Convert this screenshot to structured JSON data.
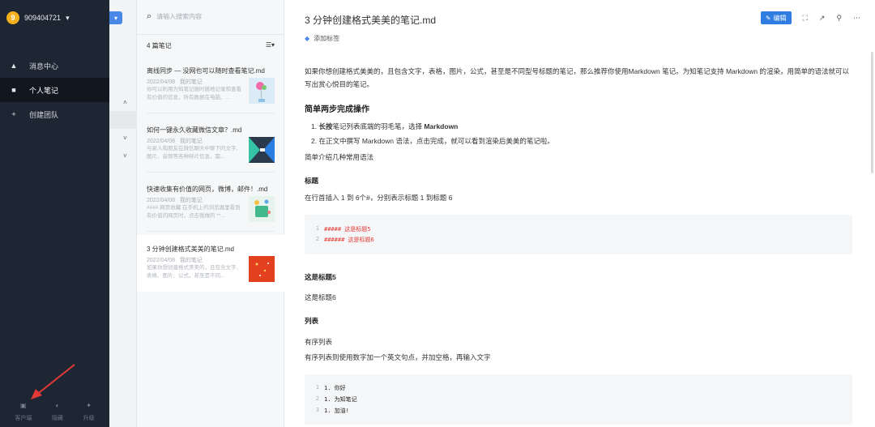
{
  "sidebar": {
    "avatar_text": "9",
    "username": "909404721",
    "nav": [
      {
        "label": "消息中心",
        "icon": "bell-icon",
        "glyph": "▲"
      },
      {
        "label": "个人笔记",
        "icon": "note-icon",
        "glyph": "■"
      },
      {
        "label": "创建团队",
        "icon": "plus-icon",
        "glyph": "+"
      }
    ],
    "bottom": [
      {
        "label": "客户端",
        "icon": "client-icon",
        "glyph": "▣"
      },
      {
        "label": "隐藏",
        "icon": "hide-icon",
        "glyph": "◐"
      },
      {
        "label": "升级",
        "icon": "upgrade-icon",
        "glyph": "✦"
      }
    ]
  },
  "notelist": {
    "search_placeholder": "请输入搜索内容",
    "count_label": "4 篇笔记",
    "notes": [
      {
        "title": "离线同步 — 没网也可以随时查看笔记.md",
        "date": "2022/04/08",
        "folder": "我的笔记",
        "snippet": "你可以利用为知笔记随时随地记录和查看有价值的信息，所有数据在电脑、..."
      },
      {
        "title": "如何一键永久收藏微信文章？.md",
        "date": "2022/04/08",
        "folder": "我的笔记",
        "snippet": "与家人和朋友在微信聊天中聊下的文字、图片、音频等各种碎片信息，需..."
      },
      {
        "title": "快速收集有价值的网页，微博，邮件！.md",
        "date": "2022/04/08",
        "folder": "我的笔记",
        "snippet": "#### 网页收藏 在手机上的浏览器里看到有价值的网页时，点击我做的 **..."
      },
      {
        "title": "3 分钟创建格式美美的笔记.md",
        "date": "2022/04/08",
        "folder": "我的笔记",
        "snippet": "如果你想创建格式美美的，且包含文字、表格、图片、公式，甚至是不同..."
      }
    ]
  },
  "editor": {
    "title": "3 分钟创建格式美美的笔记.md",
    "edit_label": "编辑",
    "add_tag": "添加标签",
    "intro": "如果你想创建格式美美的，且包含文字，表格，图片，公式，甚至是不同型号标题的笔记，那么推荐你使用Markdown 笔记。为知笔记支持 Markdown 的渲染，用简单的语法就可以写出赏心悦目的笔记。",
    "h_simple": "简单两步完成操作",
    "step1_pre": "长按",
    "step1_mid": "笔记列表底端的羽毛笔，选择 ",
    "step1_bold": "Markdown",
    "step2": "在正文中撰写 Markdown 语法，点击完成，就可以看到渲染后美美的笔记啦。",
    "simple_intro": "简单介绍几种常用语法",
    "h_title": "标题",
    "title_desc": "在行首插入 1 到 6个#，分别表示标题 1 到标题 6",
    "code1": [
      {
        "n": "1",
        "text": "##### 这是标题5"
      },
      {
        "n": "2",
        "text": "###### 这是标题6"
      }
    ],
    "h5_rendered": "这是标题5",
    "h6_rendered": "这是标题6",
    "h_list": "列表",
    "ordered": "有序列表",
    "ordered_desc": "有序列表则使用数字加一个英文句点，并加空格，再输入文字",
    "code2": [
      {
        "n": "1",
        "text": "1. 你好"
      },
      {
        "n": "2",
        "text": "1. 为知笔记"
      },
      {
        "n": "3",
        "text": "1. 加油!"
      }
    ]
  },
  "colors": {
    "sidebar_bg": "#1f2633",
    "accent": "#2f7de1",
    "code_red": "#e53935"
  }
}
